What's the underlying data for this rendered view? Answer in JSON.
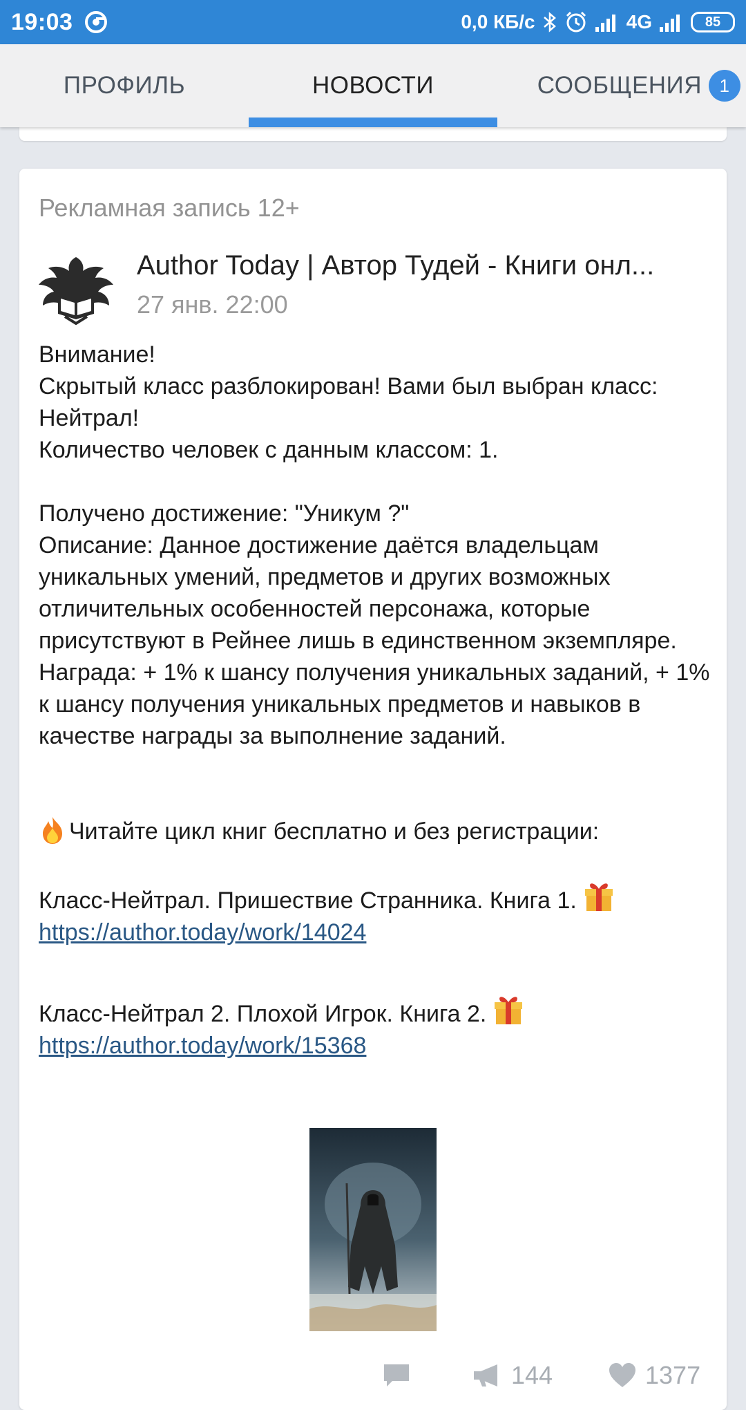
{
  "status_bar": {
    "time": "19:03",
    "speed": "0,0 КБ/с",
    "network": "4G",
    "battery": "85"
  },
  "tabs": [
    {
      "label": "ПРОФИЛЬ",
      "active": false
    },
    {
      "label": "НОВОСТИ",
      "active": true
    },
    {
      "label": "СООБЩЕНИЯ",
      "active": false,
      "badge": "1"
    }
  ],
  "post": {
    "ad_label": "Рекламная запись 12+",
    "author": "Author Today | Автор Тудей - Книги онл...",
    "date": "27 янв. 22:00",
    "text_block_1": "Внимание!\nСкрытый класс разблокирован! Вами был выбран класс: Нейтрал!\nКоличество человек с данным классом: 1.",
    "text_block_2": "Получено достижение: \"Уникум ?\"\nОписание: Данное достижение даётся владельцам уникальных умений, предметов и других возможных отличительных особенностей персонажа, которые присутствуют в Рейнее лишь в единственном экземпляре.\nНаграда: + 1% к шансу получения уникальных заданий, + 1% к шансу получения уникальных предметов и навыков в качестве награды за выполнение заданий.",
    "cta": "Читайте цикл книг бесплатно и без регистрации:",
    "book_1_title": "Класс-Нейтрал. Пришествие Странника. Книга 1.",
    "book_1_link": "https://author.today/work/14024",
    "book_2_title": "Класс-Нейтрал 2. Плохой Игрок. Книга 2.",
    "book_2_link": "https://author.today/work/15368"
  },
  "actions": {
    "shares": "144",
    "likes": "1377"
  },
  "colors": {
    "status_bar": "#2f86d6",
    "accent": "#3d8ee3",
    "link": "#2a5885"
  }
}
